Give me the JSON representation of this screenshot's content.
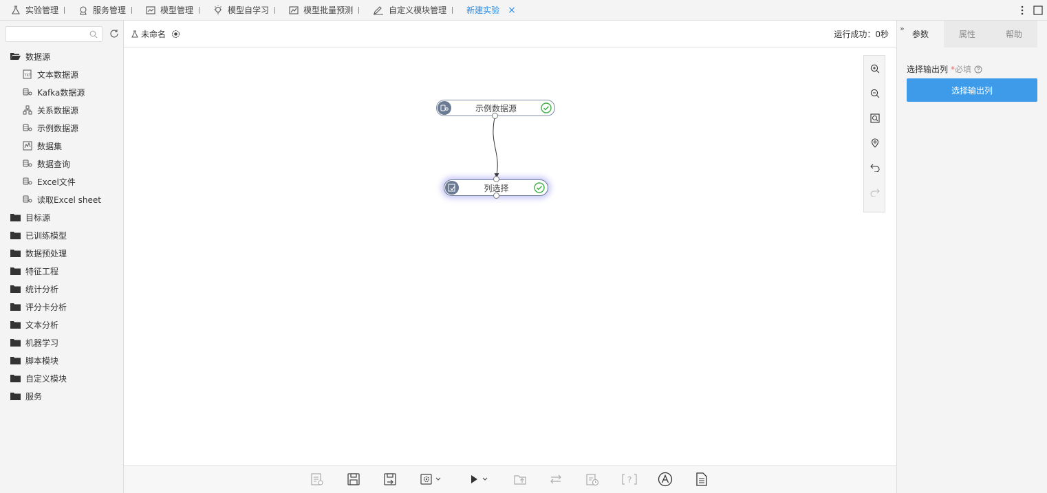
{
  "tabs": [
    {
      "label": "实验管理",
      "icon": "flask-icon"
    },
    {
      "label": "服务管理",
      "icon": "service-icon"
    },
    {
      "label": "模型管理",
      "icon": "chart-icon"
    },
    {
      "label": "模型自学习",
      "icon": "bulb-icon"
    },
    {
      "label": "模型批量预测",
      "icon": "trend-icon"
    },
    {
      "label": "自定义模块管理",
      "icon": "pencil-icon"
    },
    {
      "label": "新建实验",
      "icon": ""
    }
  ],
  "close_symbol": "×",
  "search": {
    "placeholder": "",
    "value": ""
  },
  "tree": {
    "open_folder": "数据源",
    "children": [
      "文本数据源",
      "Kafka数据源",
      "关系数据源",
      "示例数据源",
      "数据集",
      "数据查询",
      "Excel文件",
      "读取Excel sheet"
    ],
    "folders": [
      "目标源",
      "已训练模型",
      "数据预处理",
      "特征工程",
      "统计分析",
      "评分卡分析",
      "文本分析",
      "机器学习",
      "脚本模块",
      "自定义模块",
      "服务"
    ]
  },
  "experiment": {
    "name": "未命名",
    "status": "运行成功：0秒"
  },
  "nodes": [
    {
      "label": "示例数据源",
      "icon": "database-icon"
    },
    {
      "label": "列选择",
      "icon": "column-select-icon"
    }
  ],
  "right_panel": {
    "tabs": [
      "参数",
      "属性",
      "帮助"
    ],
    "collapse": "»",
    "param_label": "选择输出列",
    "required_star": "*",
    "required_text": "必填",
    "button": "选择输出列"
  },
  "colors": {
    "accent": "#2a8ee8",
    "button": "#3d9be9",
    "node_icon": "#6b7a93",
    "ok": "#3cb043"
  }
}
